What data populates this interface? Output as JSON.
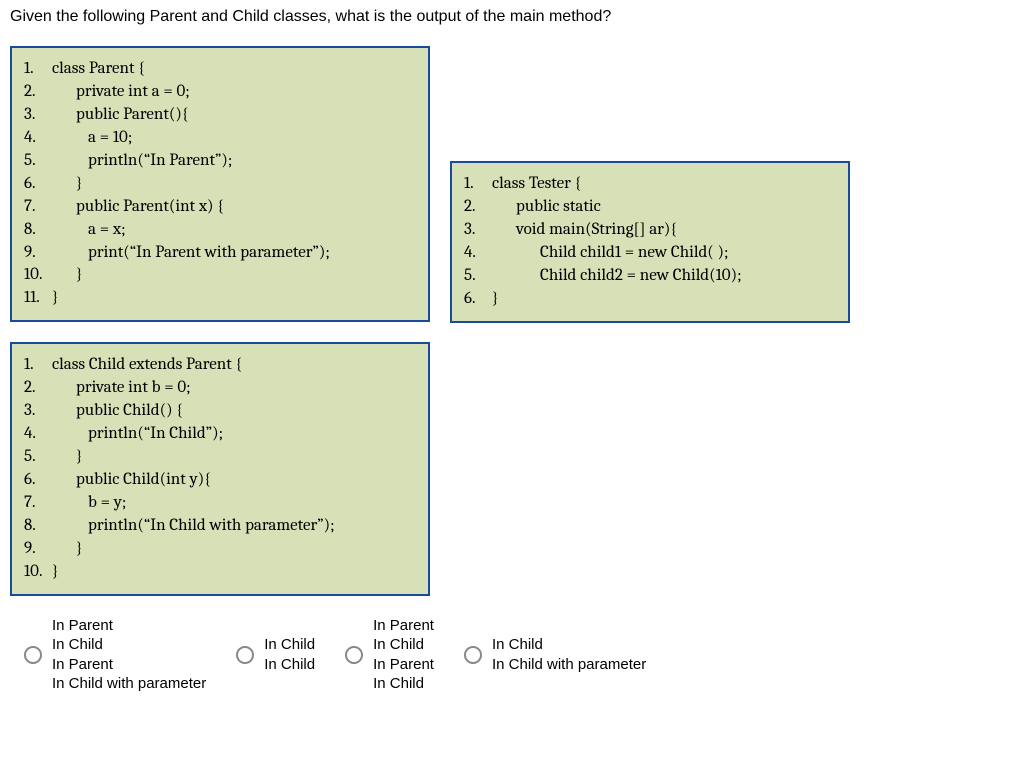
{
  "question": "Given the following Parent and Child classes, what is the output of the main method?",
  "code_parent": [
    {
      "n": "1.",
      "t": "class Parent {",
      "ind": 0
    },
    {
      "n": "2.",
      "t": "private int a = 0;",
      "ind": 1
    },
    {
      "n": "3.",
      "t": "public Parent(){",
      "ind": 1
    },
    {
      "n": "4.",
      "t": "a = 10;",
      "ind": 2
    },
    {
      "n": "5.",
      "t": "println(“In Parent”);",
      "ind": 2
    },
    {
      "n": "6.",
      "t": "}",
      "ind": 1
    },
    {
      "n": "7.",
      "t": "public Parent(int x) {",
      "ind": 1
    },
    {
      "n": "8.",
      "t": "a = x;",
      "ind": 2
    },
    {
      "n": "9.",
      "t": "print(“In Parent with parameter”);",
      "ind": 2
    },
    {
      "n": "10.",
      "t": "}",
      "ind": 1
    },
    {
      "n": "11.",
      "t": "}",
      "ind": 0
    }
  ],
  "code_child": [
    {
      "n": "1.",
      "t": "class Child extends Parent {",
      "ind": 0
    },
    {
      "n": "2.",
      "t": "private int b = 0;",
      "ind": 1
    },
    {
      "n": "3.",
      "t": "public Child() {",
      "ind": 1
    },
    {
      "n": "4.",
      "t": "println(“In Child”);",
      "ind": 2
    },
    {
      "n": "5.",
      "t": "}",
      "ind": 1
    },
    {
      "n": "6.",
      "t": "public Child(int y){",
      "ind": 1
    },
    {
      "n": "7.",
      "t": "b = y;",
      "ind": 2
    },
    {
      "n": "8.",
      "t": "println(“In Child with parameter”);",
      "ind": 2
    },
    {
      "n": "9.",
      "t": "}",
      "ind": 1
    },
    {
      "n": "10.",
      "t": "}",
      "ind": 0
    }
  ],
  "code_tester": [
    {
      "n": "1.",
      "t": "class Tester {",
      "ind": 0
    },
    {
      "n": "2.",
      "t": "public static",
      "ind": 1
    },
    {
      "n": "3.",
      "t": "void main(String[] ar){",
      "ind": 1
    },
    {
      "n": "4.",
      "t": "Child child1 = new Child( );",
      "ind": 3
    },
    {
      "n": "5.",
      "t": "Child child2 = new Child(10);",
      "ind": 3
    },
    {
      "n": "6.",
      "t": "}",
      "ind": 0
    }
  ],
  "answers": [
    "In Parent\nIn Child\nIn Parent\nIn Child with parameter",
    "In Child\nIn Child",
    "In Parent\nIn Child\nIn Parent\nIn Child",
    "In Child\nIn Child with parameter"
  ]
}
